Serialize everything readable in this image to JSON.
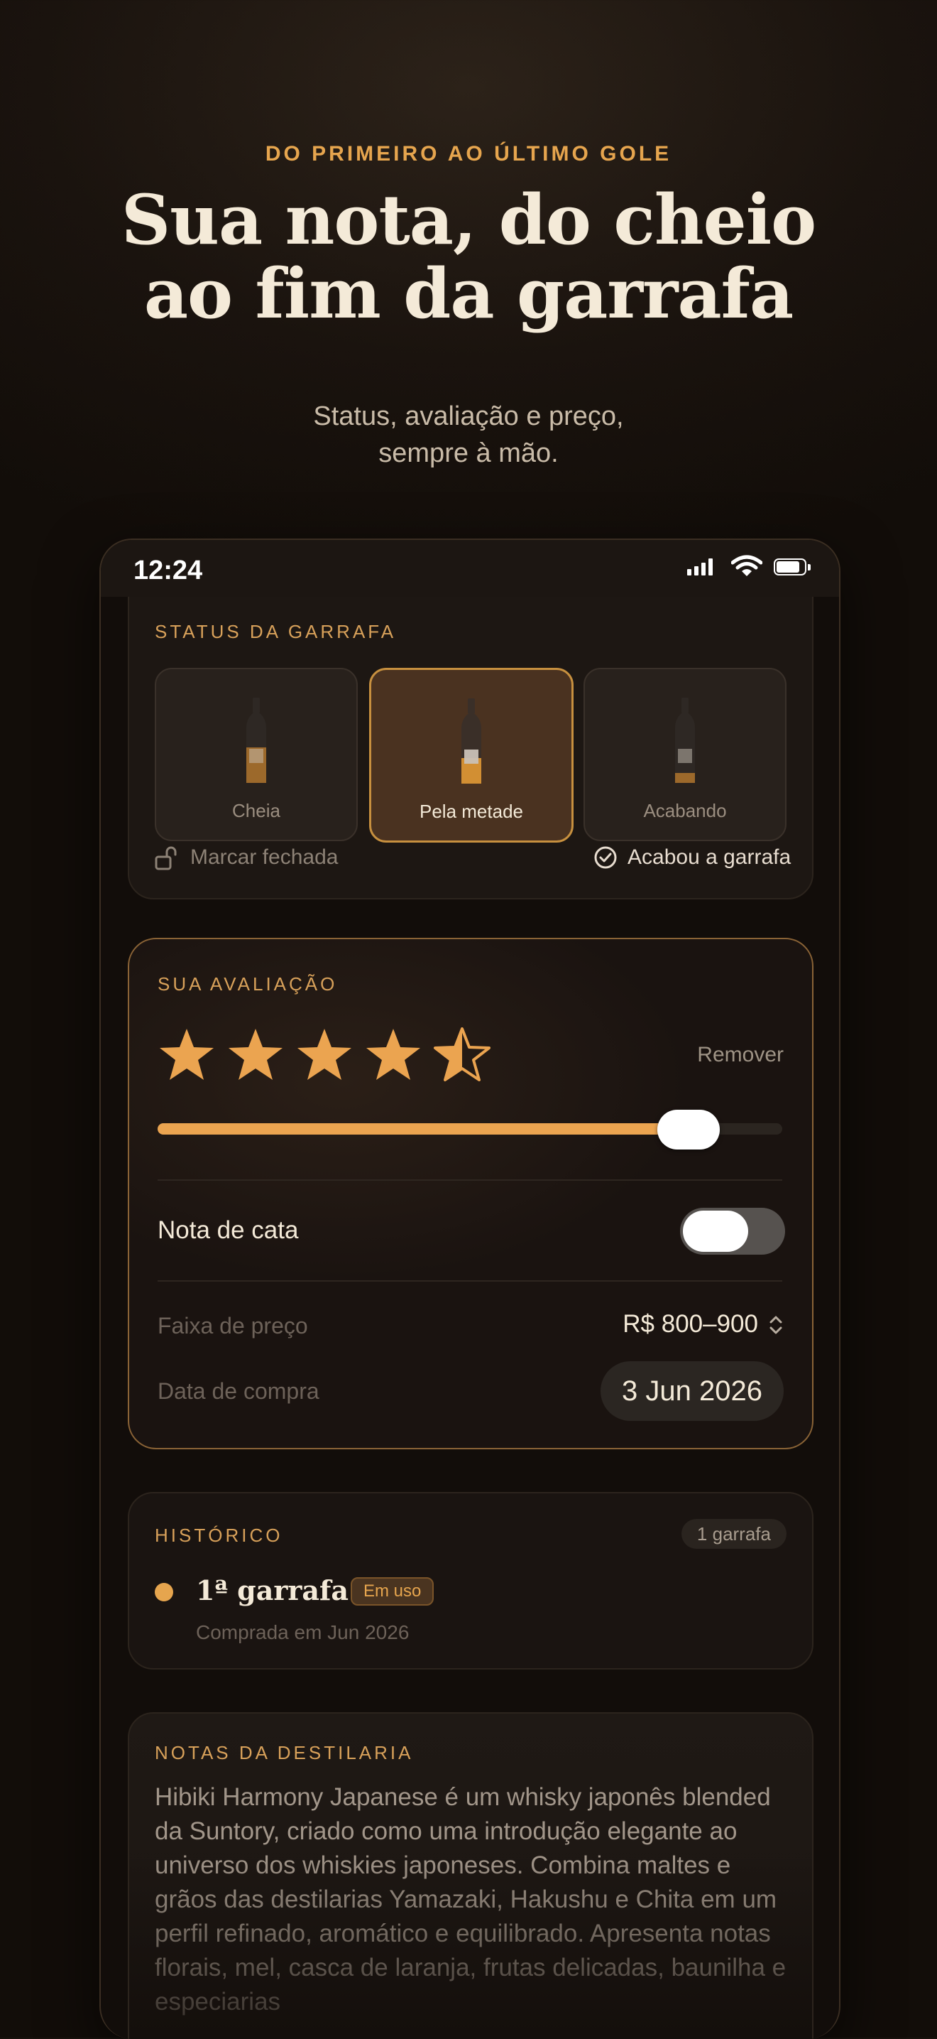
{
  "hero": {
    "eyebrow": "DO PRIMEIRO AO ÚLTIMO GOLE",
    "title_line1": "Sua nota, do cheio",
    "title_line2": "ao fim da garrafa",
    "subtitle_line1": "Status, avaliação e preço,",
    "subtitle_line2": "sempre à mão."
  },
  "statusbar": {
    "time": "12:24",
    "battery_level": 0.85
  },
  "bottle_status": {
    "label": "STATUS DA GARRAFA",
    "options": [
      {
        "label": "Cheia",
        "fill_level": 0.55,
        "selected": false
      },
      {
        "label": "Pela metade",
        "fill_level": 0.4,
        "selected": true
      },
      {
        "label": "Acabando",
        "fill_level": 0.15,
        "selected": false
      }
    ],
    "mark_closed": "Marcar fechada",
    "finished": "Acabou a garrafa"
  },
  "rating": {
    "label": "SUA AVALIAÇÃO",
    "stars": 4.5,
    "max_stars": 5,
    "remove": "Remover",
    "slider_value": 0.85,
    "tasting_note_label": "Nota de cata",
    "tasting_note_on": false,
    "price_label": "Faixa de preço",
    "price_value": "R$ 800–900",
    "date_label": "Data de compra",
    "date_value": "3 Jun 2026"
  },
  "history": {
    "label": "HISTÓRICO",
    "badge": "1 garrafa",
    "item_title": "1ª garrafa",
    "item_badge": "Em uso",
    "item_sub": "Comprada em Jun 2026"
  },
  "notes": {
    "label": "NOTAS DA DESTILARIA",
    "text": "Hibiki Harmony Japanese é um whisky japonês blended da Suntory, criado como uma introdução elegante ao universo dos whiskies japoneses. Combina maltes e grãos das destilarias Yamazaki, Hakushu e Chita em um perfil refinado, aromático e equilibrado. Apresenta notas florais, mel, casca de laranja, frutas delicadas, baunilha e especiarias"
  },
  "colors": {
    "accent": "#e6a54e",
    "background": "#120d0a",
    "card": "#1d1713"
  }
}
